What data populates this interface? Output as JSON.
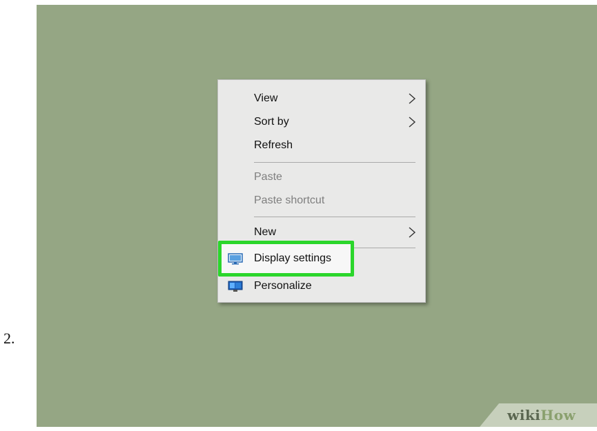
{
  "step_number": "2.",
  "context_menu": {
    "items": [
      {
        "label": "View",
        "has_submenu": true,
        "disabled": false
      },
      {
        "label": "Sort by",
        "has_submenu": true,
        "disabled": false
      },
      {
        "label": "Refresh",
        "has_submenu": false,
        "disabled": false
      },
      {
        "label": "Paste",
        "has_submenu": false,
        "disabled": true
      },
      {
        "label": "Paste shortcut",
        "has_submenu": false,
        "disabled": true
      },
      {
        "label": "New",
        "has_submenu": true,
        "disabled": false
      },
      {
        "label": "Display settings",
        "icon": "display-icon",
        "highlighted": true,
        "disabled": false
      },
      {
        "label": "Personalize",
        "icon": "personalize-icon",
        "disabled": false
      }
    ]
  },
  "highlight_color": "#2bd62b",
  "desktop_color": "#95a684",
  "watermark": {
    "wiki": "wiki",
    "how": "How"
  }
}
